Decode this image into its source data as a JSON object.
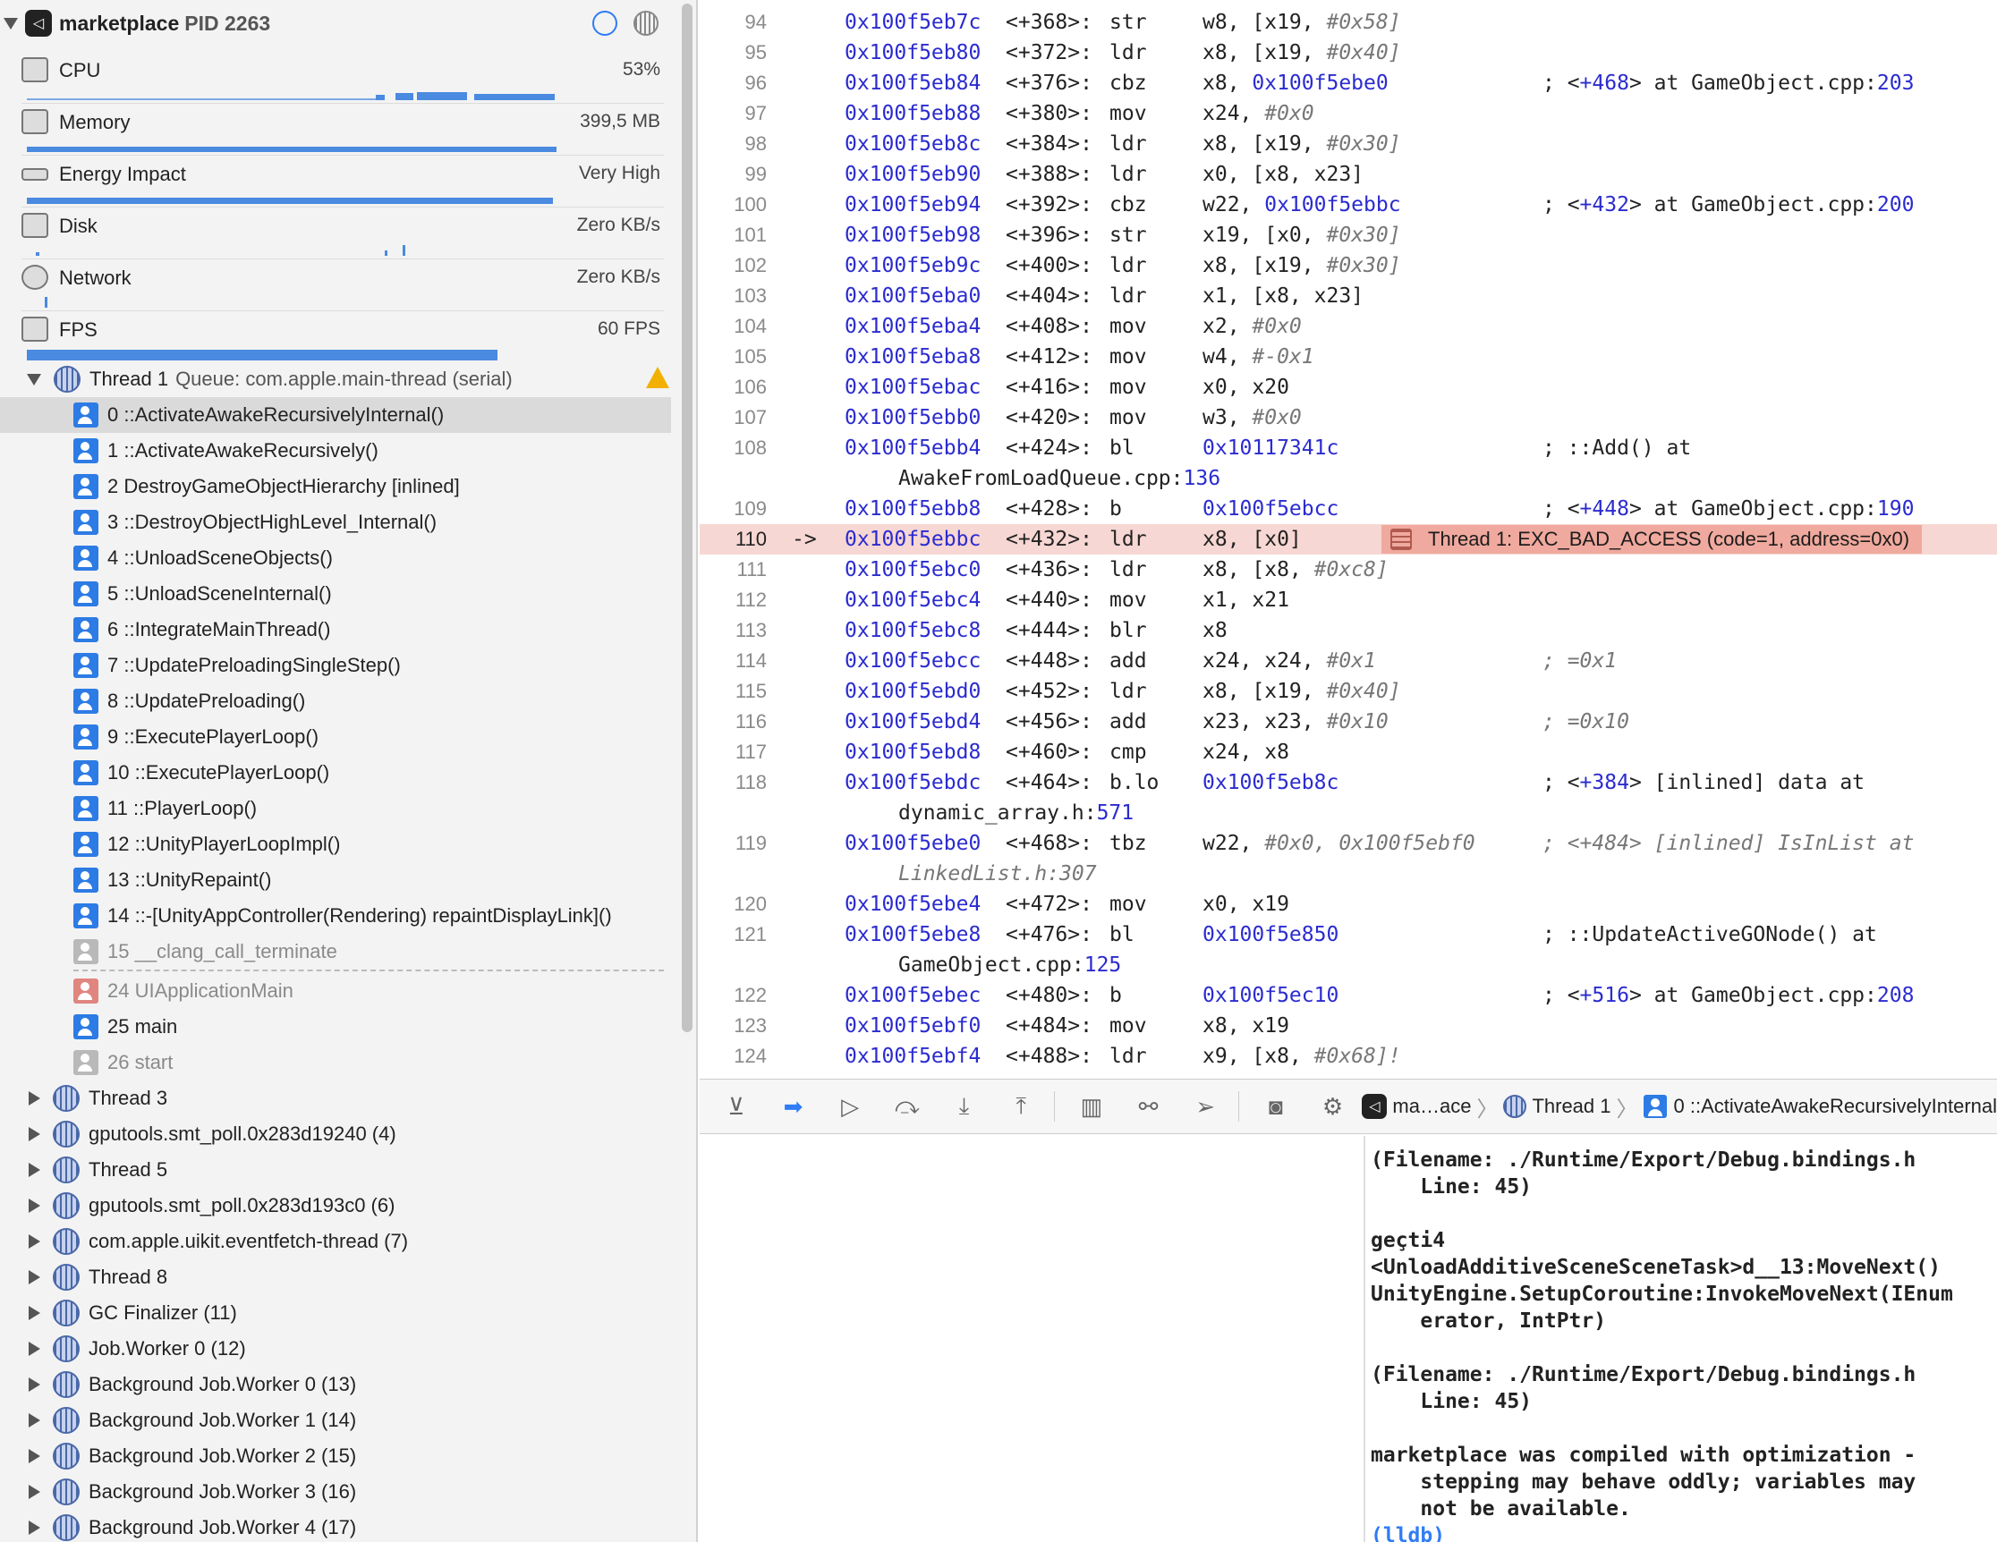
{
  "process": {
    "name": "marketplace",
    "pid": "PID 2263"
  },
  "gauges": [
    {
      "label": "CPU",
      "value": "53%"
    },
    {
      "label": "Memory",
      "value": "399,5 MB"
    },
    {
      "label": "Energy Impact",
      "value": "Very High"
    },
    {
      "label": "Disk",
      "value": "Zero KB/s"
    },
    {
      "label": "Network",
      "value": "Zero KB/s"
    },
    {
      "label": "FPS",
      "value": "60 FPS"
    }
  ],
  "thread1": {
    "name": "Thread 1",
    "queue": "Queue: com.apple.main-thread (serial)"
  },
  "frames": [
    "0 ::ActivateAwakeRecursivelyInternal()",
    "1 ::ActivateAwakeRecursively()",
    "2 DestroyGameObjectHierarchy [inlined]",
    "3 ::DestroyObjectHighLevel_Internal()",
    "4 ::UnloadSceneObjects()",
    "5 ::UnloadSceneInternal()",
    "6 ::IntegrateMainThread()",
    "7 ::UpdatePreloadingSingleStep()",
    "8 ::UpdatePreloading()",
    "9 ::ExecutePlayerLoop()",
    "10 ::ExecutePlayerLoop()",
    "11 ::PlayerLoop()",
    "12 ::UnityPlayerLoopImpl()",
    "13 ::UnityRepaint()",
    "14 ::-[UnityAppController(Rendering) repaintDisplayLink]()",
    "15 __clang_call_terminate",
    "24 UIApplicationMain",
    "25 main",
    "26 start"
  ],
  "threads": [
    "Thread 3",
    "gputools.smt_poll.0x283d19240 (4)",
    "Thread 5",
    "gputools.smt_poll.0x283d193c0 (6)",
    "com.apple.uikit.eventfetch-thread (7)",
    "Thread 8",
    "GC Finalizer (11)",
    "Job.Worker 0 (12)",
    "Background Job.Worker 0 (13)",
    "Background Job.Worker 1 (14)",
    "Background Job.Worker 2 (15)",
    "Background Job.Worker 3 (16)",
    "Background Job.Worker 4 (17)"
  ],
  "disasm": [
    {
      "ln": "94",
      "addr": "0x100f5eb7c",
      "off": "<+368>:",
      "op": "str",
      "a": "w8, [x19, ",
      "ai": "#0x58]"
    },
    {
      "ln": "95",
      "addr": "0x100f5eb80",
      "off": "<+372>:",
      "op": "ldr",
      "a": "x8, [x19, ",
      "ai": "#0x40]"
    },
    {
      "ln": "96",
      "addr": "0x100f5eb84",
      "off": "<+376>:",
      "op": "cbz",
      "a": "x8, ",
      "ab": "0x100f5ebe0",
      "c1": "; <",
      "c2": "+468",
      "c3": "> at GameObject.cpp:",
      "c4": "203"
    },
    {
      "ln": "97",
      "addr": "0x100f5eb88",
      "off": "<+380>:",
      "op": "mov",
      "a": "x24, ",
      "ai": "#0x0"
    },
    {
      "ln": "98",
      "addr": "0x100f5eb8c",
      "off": "<+384>:",
      "op": "ldr",
      "a": "x8, [x19, ",
      "ai": "#0x30]"
    },
    {
      "ln": "99",
      "addr": "0x100f5eb90",
      "off": "<+388>:",
      "op": "ldr",
      "a": "x0, [x8, x23]"
    },
    {
      "ln": "100",
      "addr": "0x100f5eb94",
      "off": "<+392>:",
      "op": "cbz",
      "a": "w22, ",
      "ab": "0x100f5ebbc",
      "c1": "; <",
      "c2": "+432",
      "c3": "> at GameObject.cpp:",
      "c4": "200"
    },
    {
      "ln": "101",
      "addr": "0x100f5eb98",
      "off": "<+396>:",
      "op": "str",
      "a": "x19, [x0, ",
      "ai": "#0x30]"
    },
    {
      "ln": "102",
      "addr": "0x100f5eb9c",
      "off": "<+400>:",
      "op": "ldr",
      "a": "x8, [x19, ",
      "ai": "#0x30]"
    },
    {
      "ln": "103",
      "addr": "0x100f5eba0",
      "off": "<+404>:",
      "op": "ldr",
      "a": "x1, [x8, x23]"
    },
    {
      "ln": "104",
      "addr": "0x100f5eba4",
      "off": "<+408>:",
      "op": "mov",
      "a": "x2, ",
      "ai": "#0x0"
    },
    {
      "ln": "105",
      "addr": "0x100f5eba8",
      "off": "<+412>:",
      "op": "mov",
      "a": "w4, ",
      "ai": "#-0x1"
    },
    {
      "ln": "106",
      "addr": "0x100f5ebac",
      "off": "<+416>:",
      "op": "mov",
      "a": "x0, x20"
    },
    {
      "ln": "107",
      "addr": "0x100f5ebb0",
      "off": "<+420>:",
      "op": "mov",
      "a": "w3, ",
      "ai": "#0x0"
    },
    {
      "ln": "108",
      "addr": "0x100f5ebb4",
      "off": "<+424>:",
      "op": "bl",
      "ab": "0x10117341c",
      "c1": "; ::Add() at",
      "cont1": "AwakeFromLoadQueue.cpp:",
      "cont2": "136"
    },
    {
      "ln": "109",
      "addr": "0x100f5ebb8",
      "off": "<+428>:",
      "op": "b",
      "ab": "0x100f5ebcc",
      "c1": "; <",
      "c2": "+448",
      "c3": "> at GameObject.cpp:",
      "c4": "190"
    },
    {
      "ln": "110",
      "arrow": "->",
      "addr": "0x100f5ebbc",
      "off": "<+432>:",
      "op": "ldr",
      "a": "x8, [x0]",
      "error": "Thread 1: EXC_BAD_ACCESS (code=1, address=0x0)"
    },
    {
      "ln": "111",
      "addr": "0x100f5ebc0",
      "off": "<+436>:",
      "op": "ldr",
      "a": "x8, [x8, ",
      "ai": "#0xc8]"
    },
    {
      "ln": "112",
      "addr": "0x100f5ebc4",
      "off": "<+440>:",
      "op": "mov",
      "a": "x1, x21"
    },
    {
      "ln": "113",
      "addr": "0x100f5ebc8",
      "off": "<+444>:",
      "op": "blr",
      "a": "x8"
    },
    {
      "ln": "114",
      "addr": "0x100f5ebcc",
      "off": "<+448>:",
      "op": "add",
      "a": "x24, x24, ",
      "ai": "#0x1",
      "cg": "; =0x1"
    },
    {
      "ln": "115",
      "addr": "0x100f5ebd0",
      "off": "<+452>:",
      "op": "ldr",
      "a": "x8, [x19, ",
      "ai": "#0x40]"
    },
    {
      "ln": "116",
      "addr": "0x100f5ebd4",
      "off": "<+456>:",
      "op": "add",
      "a": "x23, x23, ",
      "ai": "#0x10",
      "cg": "; =0x10"
    },
    {
      "ln": "117",
      "addr": "0x100f5ebd8",
      "off": "<+460>:",
      "op": "cmp",
      "a": "x24, x8"
    },
    {
      "ln": "118",
      "addr": "0x100f5ebdc",
      "off": "<+464>:",
      "op": "b.lo",
      "ab": "0x100f5eb8c",
      "c1": "; <",
      "c2": "+384",
      "c3": "> [inlined] data at",
      "cont1": "dynamic_array.h:",
      "cont2": "571"
    },
    {
      "ln": "119",
      "addr": "0x100f5ebe0",
      "off": "<+468>:",
      "op": "tbz",
      "a": "w22, ",
      "ai": "#0x0, 0x100f5ebf0",
      "cg": "; <+484> [inlined] IsInList at",
      "contg": "LinkedList.h:307"
    },
    {
      "ln": "120",
      "addr": "0x100f5ebe4",
      "off": "<+472>:",
      "op": "mov",
      "a": "x0, x19"
    },
    {
      "ln": "121",
      "addr": "0x100f5ebe8",
      "off": "<+476>:",
      "op": "bl",
      "ab": "0x100f5e850",
      "c1": "; ::UpdateActiveGONode() at",
      "cont1": "GameObject.cpp:",
      "cont2": "125"
    },
    {
      "ln": "122",
      "addr": "0x100f5ebec",
      "off": "<+480>:",
      "op": "b",
      "ab": "0x100f5ec10",
      "c1": "; <",
      "c2": "+516",
      "c3": "> at GameObject.cpp:",
      "c4": "208"
    },
    {
      "ln": "123",
      "addr": "0x100f5ebf0",
      "off": "<+484>:",
      "op": "mov",
      "a": "x8, x19"
    },
    {
      "ln": "124",
      "addr": "0x100f5ebf4",
      "off": "<+488>:",
      "op": "ldr",
      "a": "x9, [x8, ",
      "ai": "#0x68]!"
    }
  ],
  "breadcrumb": {
    "app": "ma…ace",
    "thread": "Thread 1",
    "frame": "0 ::ActivateAwakeRecursivelyInternal"
  },
  "console": [
    "(Filename: ./Runtime/Export/Debug.bindings.h",
    "    Line: 45)",
    "",
    "geçti4",
    "<UnloadAdditiveSceneSceneTask>d__13:MoveNext()",
    "UnityEngine.SetupCoroutine:InvokeMoveNext(IEnum",
    "    erator, IntPtr)",
    "",
    "(Filename: ./Runtime/Export/Debug.bindings.h",
    "    Line: 45)",
    "",
    "marketplace was compiled with optimization -",
    "    stepping may behave oddly; variables may",
    "    not be available."
  ],
  "prompt": "(lldb)",
  "colors": {
    "accent": "#2f7cf6",
    "error_line": "#f7d7d3",
    "error_badge": "#f0a99e",
    "address": "#2b2bd0"
  }
}
